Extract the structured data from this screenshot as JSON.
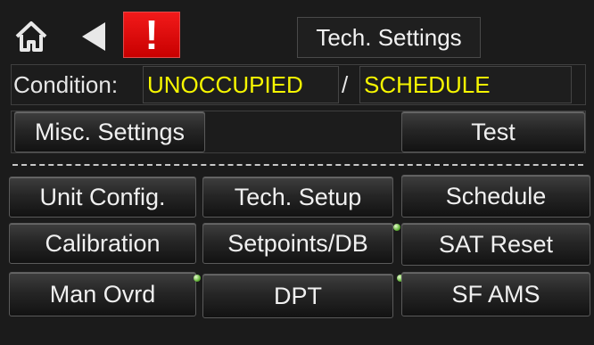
{
  "header": {
    "home_icon": "home-icon",
    "back_icon": "back-icon",
    "alert_icon": "alert-icon",
    "alert_symbol": "!",
    "title": "Tech. Settings"
  },
  "condition": {
    "label": "Condition:",
    "occupancy": "UNOCCUPIED",
    "separator": "/",
    "mode": "SCHEDULE"
  },
  "actions": {
    "misc_settings": "Misc. Settings",
    "test": "Test"
  },
  "menu": {
    "unit_config": "Unit Config.",
    "tech_setup": "Tech. Setup",
    "schedule": "Schedule",
    "calibration": "Calibration",
    "setpoints_db": "Setpoints/DB",
    "sat_reset": "SAT Reset",
    "man_ovrd": "Man Ovrd",
    "dpt": "DPT",
    "sf_ams": "SF AMS"
  },
  "colors": {
    "background": "#1b1b1b",
    "condition_value": "#f6f600",
    "alert": "#e00000",
    "indicator_dot": "#64b33a"
  }
}
